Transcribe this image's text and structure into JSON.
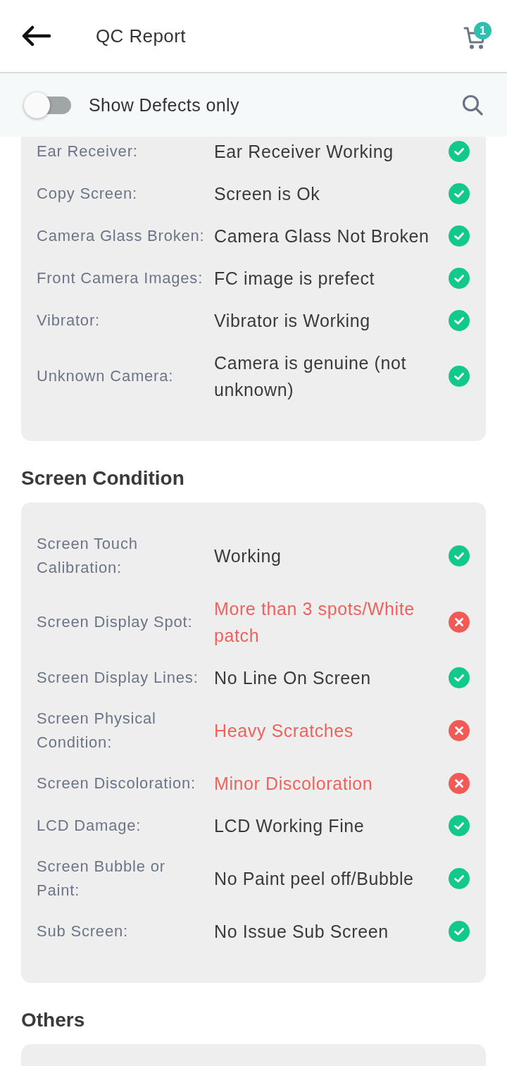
{
  "header": {
    "title": "QC Report",
    "cart_count": "1"
  },
  "filter": {
    "label": "Show Defects only",
    "on": false
  },
  "sections": [
    {
      "rows": [
        {
          "label": "Ear Receiver:",
          "value": "Ear Receiver Working",
          "defect": false
        },
        {
          "label": "Copy Screen:",
          "value": "Screen is Ok",
          "defect": false
        },
        {
          "label": "Camera Glass Broken:",
          "value": "Camera Glass Not Broken",
          "defect": false
        },
        {
          "label": "Front Camera Images:",
          "value": "FC image is prefect",
          "defect": false
        },
        {
          "label": "Vibrator:",
          "value": "Vibrator is Working",
          "defect": false
        },
        {
          "label": "Unknown Camera:",
          "value": "Camera is genuine (not unknown)",
          "defect": false
        }
      ]
    },
    {
      "title": "Screen Condition",
      "rows": [
        {
          "label": "Screen Touch Calibration:",
          "value": "Working",
          "defect": false
        },
        {
          "label": "Screen Display Spot:",
          "value": "More than 3 spots/White patch",
          "defect": true
        },
        {
          "label": "Screen Display Lines:",
          "value": "No Line On Screen",
          "defect": false
        },
        {
          "label": "Screen Physical Condition:",
          "value": "Heavy Scratches",
          "defect": true
        },
        {
          "label": "Screen Discoloration:",
          "value": "Minor Discoloration",
          "defect": true
        },
        {
          "label": "LCD Damage:",
          "value": "LCD Working Fine",
          "defect": false
        },
        {
          "label": "Screen Bubble or Paint:",
          "value": "No Paint peel off/Bubble",
          "defect": false
        },
        {
          "label": "Sub Screen:",
          "value": "No Issue Sub Screen",
          "defect": false
        }
      ]
    },
    {
      "title": "Others"
    }
  ]
}
